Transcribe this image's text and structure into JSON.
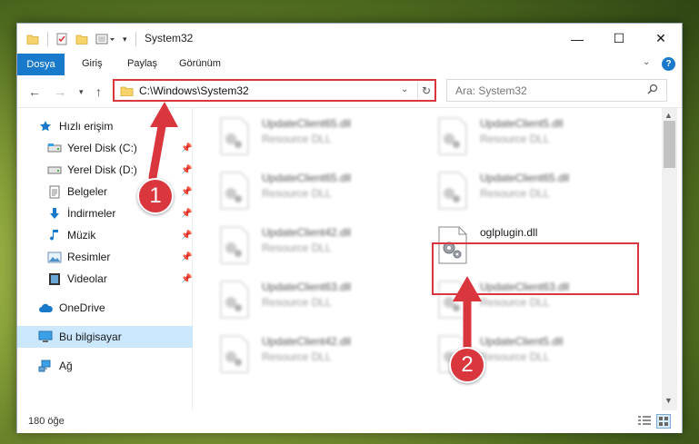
{
  "window": {
    "title": "System32",
    "controls": {
      "minimize": "—",
      "maximize": "☐",
      "close": "✕"
    }
  },
  "ribbon": {
    "tabs": [
      "Dosya",
      "Giriş",
      "Paylaş",
      "Görünüm"
    ],
    "help": "?"
  },
  "navigation": {
    "address": "C:\\Windows\\System32",
    "search_placeholder": "Ara: System32"
  },
  "sidebar": {
    "items": [
      {
        "label": "Hızlı erişim",
        "icon": "star-icon",
        "pinned": false
      },
      {
        "label": "Yerel Disk (C:)",
        "icon": "drive-icon",
        "pinned": true
      },
      {
        "label": "Yerel Disk (D:)",
        "icon": "drive-icon",
        "pinned": true
      },
      {
        "label": "Belgeler",
        "icon": "document-icon",
        "pinned": true
      },
      {
        "label": "İndirmeler",
        "icon": "download-icon",
        "pinned": true
      },
      {
        "label": "Müzik",
        "icon": "music-icon",
        "pinned": true
      },
      {
        "label": "Resimler",
        "icon": "pictures-icon",
        "pinned": true
      },
      {
        "label": "Videolar",
        "icon": "video-icon",
        "pinned": true
      },
      {
        "label": "OneDrive",
        "icon": "cloud-icon",
        "pinned": false
      },
      {
        "label": "Bu bilgisayar",
        "icon": "computer-icon",
        "pinned": false,
        "selected": true
      },
      {
        "label": "Ağ",
        "icon": "network-icon",
        "pinned": false
      }
    ]
  },
  "files": [
    {
      "name": "UpdateClient65.dll",
      "type": "Resource DLL"
    },
    {
      "name": "UpdateClient5.dll",
      "type": "Resource DLL"
    },
    {
      "name": "UpdateClient65.dll",
      "type": "Resource DLL"
    },
    {
      "name": "UpdateClient65.dll",
      "type": "Resource DLL"
    },
    {
      "name": "UpdateClient42.dll",
      "type": "Resource DLL"
    },
    {
      "name": "oglplugin.dll",
      "type": "",
      "highlighted": true
    },
    {
      "name": "UpdateClient63.dll",
      "type": "Resource DLL"
    },
    {
      "name": "UpdateClient63.dll",
      "type": "Resource DLL"
    },
    {
      "name": "UpdateClient42.dll",
      "type": "Resource DLL"
    },
    {
      "name": "UpdateClient5.dll",
      "type": "Resource DLL"
    }
  ],
  "status": {
    "item_count": "180 öğe"
  },
  "annotations": {
    "step1": "1",
    "step2": "2"
  },
  "colors": {
    "accent": "#1979ca",
    "annotation": "#d9363e",
    "selected": "#cce8ff"
  }
}
